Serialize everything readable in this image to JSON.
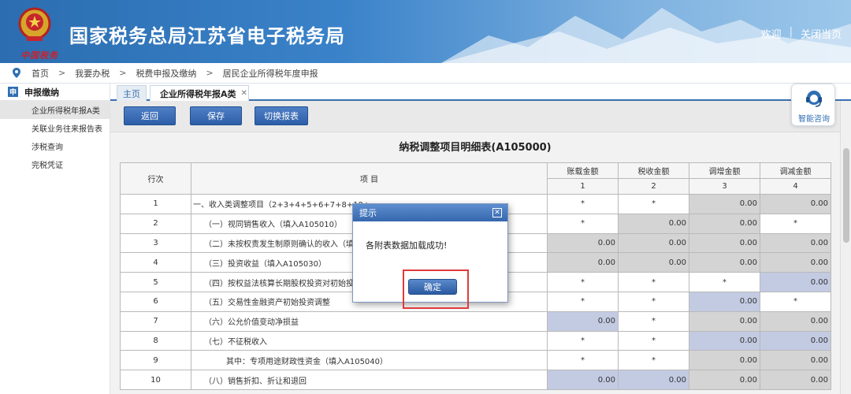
{
  "header": {
    "title": "国家税务总局江苏省电子税务局",
    "emblem_caption": "中国税务",
    "welcome": "欢迎",
    "close_page": "关闭当页"
  },
  "breadcrumb": [
    "首页",
    "我要办税",
    "税费申报及缴纳",
    "居民企业所得税年度申报"
  ],
  "sidebar": {
    "section": "申报缴纳",
    "section_icon": "申",
    "items": [
      "企业所得税年报A类",
      "关联业务往来报告表",
      "涉税查询",
      "完税凭证"
    ]
  },
  "tabs": {
    "home": "主页",
    "current": "企业所得税年报A类"
  },
  "toolbar": {
    "back": "返回",
    "save": "保存",
    "switch": "切换报表"
  },
  "form": {
    "title": "纳税调整项目明细表(A105000)",
    "headers": {
      "row_no": "行次",
      "item": "项    目",
      "c1": "账载金额",
      "c2": "税收金额",
      "c3": "调增金额",
      "c4": "调减金额",
      "n1": "1",
      "n2": "2",
      "n3": "3",
      "n4": "4"
    },
    "rows": [
      {
        "no": "1",
        "item": "一、收入类调整项目（2+3+4+5+6+7+8+10+",
        "c1": "*",
        "c2": "*",
        "c3": "0.00",
        "c4": "0.00"
      },
      {
        "no": "2",
        "item": "（一）视同销售收入（填入A105010）",
        "c1": "*",
        "c2": "0.00",
        "c3": "0.00",
        "c4": "*"
      },
      {
        "no": "3",
        "item": "（二）未按权责发生制原则确认的收入（填",
        "c1": "0.00",
        "c2": "0.00",
        "c3": "0.00",
        "c4": "0.00"
      },
      {
        "no": "4",
        "item": "（三）投资收益（填入A105030）",
        "c1": "0.00",
        "c2": "0.00",
        "c3": "0.00",
        "c4": "0.00"
      },
      {
        "no": "5",
        "item": "（四）按权益法核算长期股权投资对初始投",
        "c1": "*",
        "c2": "*",
        "c3": "*",
        "c4": "0.00"
      },
      {
        "no": "6",
        "item": "（五）交易性金融资产初始投资调整",
        "c1": "*",
        "c2": "*",
        "c3": "0.00",
        "c4": "*"
      },
      {
        "no": "7",
        "item": "（六）公允价值变动净损益",
        "c1": "0.00",
        "c2": "*",
        "c3": "0.00",
        "c4": "0.00"
      },
      {
        "no": "8",
        "item": "（七）不征税收入",
        "c1": "*",
        "c2": "*",
        "c3": "0.00",
        "c4": "0.00"
      },
      {
        "no": "9",
        "item": "其中：专项用途财政性资金（填入A105040）",
        "c1": "*",
        "c2": "*",
        "c3": "0.00",
        "c4": "0.00"
      },
      {
        "no": "10",
        "item": "（八）销售折扣、折让和退回",
        "c1": "0.00",
        "c2": "0.00",
        "c3": "0.00",
        "c4": "0.00"
      }
    ]
  },
  "dialog": {
    "title": "提示",
    "message": "各附表数据加载成功!",
    "ok": "确定",
    "close": "✕"
  },
  "assist": {
    "label": "智能咨询"
  }
}
